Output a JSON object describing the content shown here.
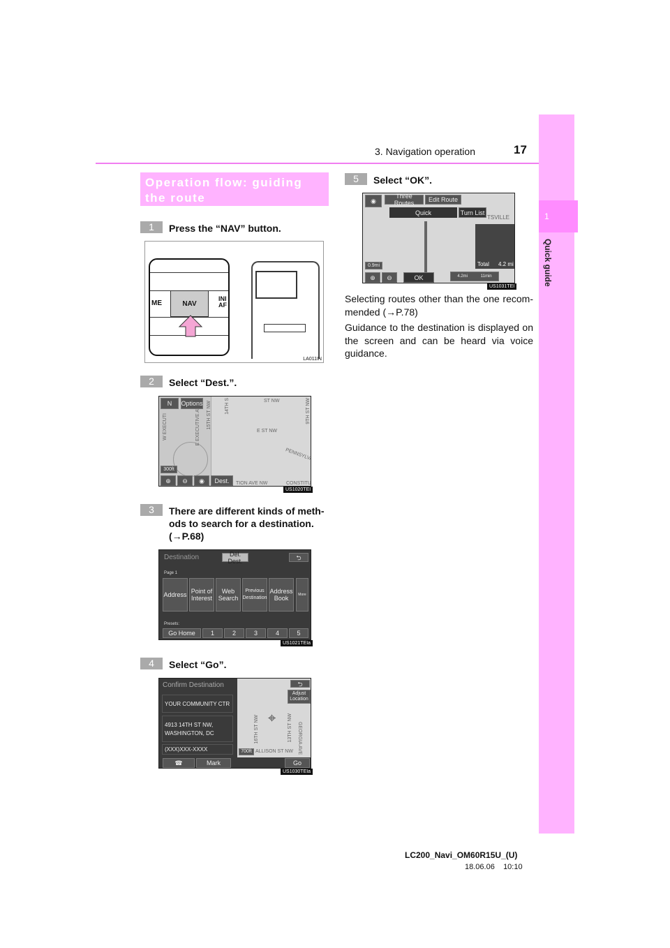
{
  "header": {
    "section": "3. Navigation operation",
    "page_number": "17"
  },
  "side_tab": {
    "chapter_number": "1",
    "chapter_label": "Quick guide"
  },
  "title": "Operation flow: guiding the route",
  "steps": [
    {
      "number": "1",
      "text": "Press the “NAV” button."
    },
    {
      "number": "2",
      "text": "Select “Dest.”."
    },
    {
      "number": "3",
      "text": "There are different kinds of meth-ods to search for a destination. (→P.68)"
    },
    {
      "number": "4",
      "text": "Select “Go”."
    },
    {
      "number": "5",
      "text": "Select “OK”."
    }
  ],
  "fig1": {
    "left_label": "ME",
    "button": "NAV",
    "right_label": "INI AF",
    "code": "LA011IN"
  },
  "fig2": {
    "north": "N",
    "options": "Options",
    "scale": "300ft",
    "dest": "Dest.",
    "streets": [
      "E ST NW",
      "14TH S",
      "15TH ST NW",
      "E EXECUTIVE AV",
      "W EXECUTI",
      "PENNSYLVA",
      "TION AVE NW",
      "CONSTITU",
      "9TH ST NW",
      "ST NW"
    ],
    "code": "US1020TEI"
  },
  "fig3": {
    "title": "Destination",
    "del_dest": "Del. Dest.",
    "page": "Page 1",
    "buttons": [
      "Address",
      "Point of Interest",
      "Web Search",
      "Previous Destination",
      "Address Book"
    ],
    "more": "More",
    "presets_label": "Presets:",
    "presets": [
      "Go Home",
      "1",
      "2",
      "3",
      "4",
      "5"
    ],
    "code": "US1021TEIa"
  },
  "fig4": {
    "title": "Confirm Destination",
    "name": "YOUR COMMUNITY CTR",
    "address": "4913 14TH ST NW, WASHINGTON, DC",
    "phone": "(XXX)XXX-XXXX",
    "mark": "Mark",
    "go": "Go",
    "adjust": "Adjust Location",
    "scale": "700ft",
    "streets": [
      "16TH ST NW",
      "13TH ST NW",
      "GEORGIA AVE",
      "ALLISON ST NW",
      "14TH ST NW"
    ],
    "code": "US1030TEIa"
  },
  "fig5": {
    "three_routes": "Three Routes",
    "edit_route": "Edit Route",
    "quick": "Quick",
    "turn_list": "Turn List",
    "place": "TSVILLE",
    "scale": "0.9mi",
    "total_label": "Total",
    "total_value": "4.2 mi",
    "ok": "OK",
    "route_dist": "4.2mi",
    "route_time": "11min",
    "code": "US1031TEI"
  },
  "notes": [
    "Selecting routes other than the one recom-mended (→P.78)",
    "Guidance to the destination is displayed on the screen and can be heard via voice guidance."
  ],
  "footer": {
    "model": "LC200_Navi_OM60R15U_(U)",
    "date": "18.06.06",
    "time": "10:10"
  }
}
